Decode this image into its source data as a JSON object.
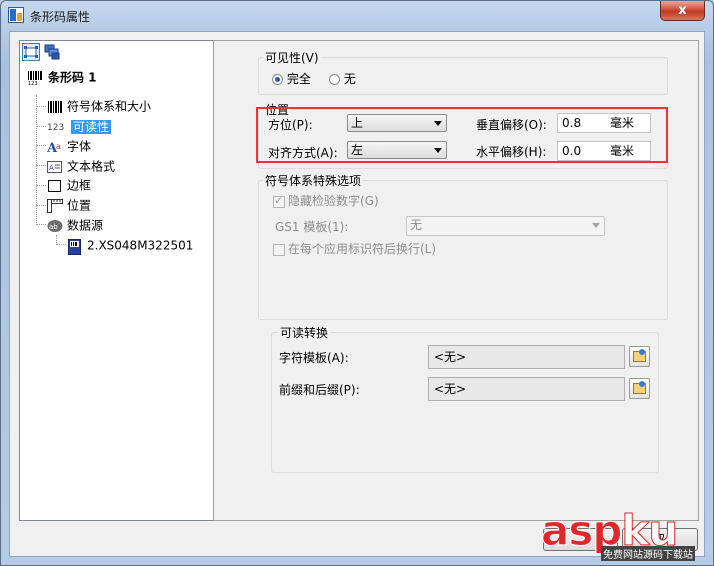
{
  "window": {
    "title": "条形码属性",
    "close_glyph": "x"
  },
  "tree": {
    "items": [
      {
        "label": "条形码 1",
        "icon": "barcode-icon"
      },
      {
        "label": "符号体系和大小",
        "icon": "barcode-lines-icon"
      },
      {
        "label": "可读性",
        "icon": "123-icon",
        "selected": true
      },
      {
        "label": "字体",
        "icon": "font-icon"
      },
      {
        "label": "文本格式",
        "icon": "text-format-icon"
      },
      {
        "label": "边框",
        "icon": "border-icon"
      },
      {
        "label": "位置",
        "icon": "ruler-icon"
      },
      {
        "label": "数据源",
        "icon": "data-source-icon"
      },
      {
        "label": "2.XS048M322501",
        "icon": "data-file-icon"
      }
    ],
    "tree_icon_prefix": "123"
  },
  "visibility": {
    "title": "可见性(V)",
    "options": [
      {
        "label": "完全",
        "checked": true
      },
      {
        "label": "无",
        "checked": false
      }
    ]
  },
  "position": {
    "title": "位置",
    "direction_label": "方位(P):",
    "direction_value": "上",
    "align_label": "对齐方式(A):",
    "align_value": "左",
    "v_offset_label": "垂直偏移(O):",
    "v_offset_value": "0.8",
    "h_offset_label": "水平偏移(H):",
    "h_offset_value": "0.0",
    "unit": "毫米"
  },
  "symbology": {
    "title": "符号体系特殊选项",
    "hide_check_digit_label": "隐藏检验数字(G)",
    "hide_check_digit_checked": true,
    "gs1_label": "GS1 模板(1):",
    "gs1_value": "无",
    "line_break_label": "在每个应用标识符后换行(L)",
    "line_break_checked": false
  },
  "conversion": {
    "title": "可读转换",
    "char_template_label": "字符模板(A):",
    "char_template_value": "<无>",
    "prefix_suffix_label": "前缀和后缀(P):",
    "prefix_suffix_value": "<无>"
  },
  "footer": {
    "partial_label": "取"
  },
  "watermark": {
    "logo": "aspku",
    "sub": "免费网站源码下载站",
    "colors": {
      "asp": "#e2262b",
      "ku": "#ffffff"
    }
  }
}
